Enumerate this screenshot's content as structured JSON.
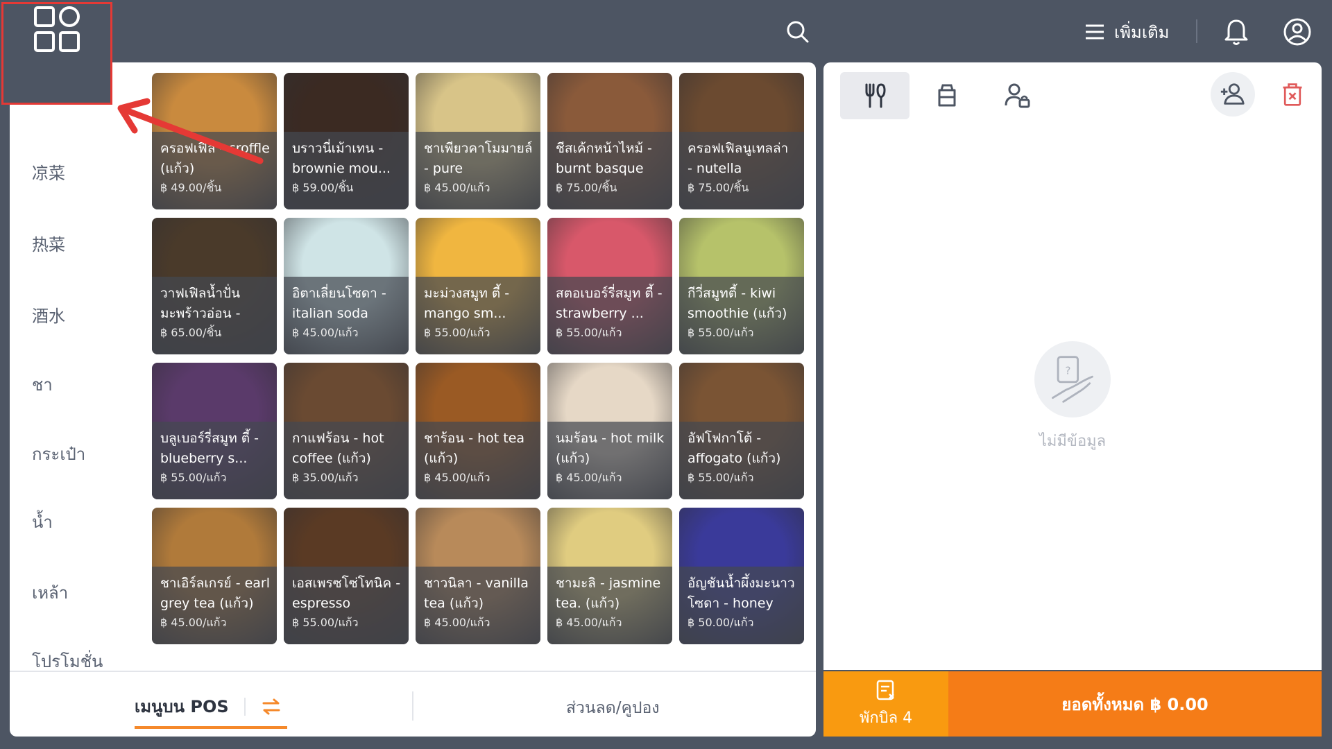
{
  "topbar": {
    "more_label": "เพิ่มเติม",
    "icons": [
      "apps-icon",
      "search-icon",
      "menu-icon",
      "bell-icon",
      "user-circle-icon"
    ]
  },
  "categories": [
    "凉菜",
    "热菜",
    "酒水",
    "ชา",
    "กระเป๋า",
    "น้ำ",
    "เหล้า",
    "โปรโมชั่น"
  ],
  "products": [
    {
      "name": "ครอฟเฟิล - croffle (แก้ว)",
      "price": "฿ 49.00/ชิ้น",
      "color": "#c98a3e"
    },
    {
      "name": "บราวนี่เม้าเทน - brownie mou...",
      "price": "฿ 59.00/ชิ้น",
      "color": "#3b2a22"
    },
    {
      "name": "ชาเพียวคาโมมายล์ - pure camomil...",
      "price": "฿ 45.00/แก้ว",
      "color": "#d8c488"
    },
    {
      "name": "ชีสเค้กหน้าไหม้ - burnt basque c...",
      "price": "฿ 75.00/ชิ้น",
      "color": "#8a5a3a"
    },
    {
      "name": "ครอฟเฟิลนูเทลล่า - nutella croffle...",
      "price": "฿ 75.00/ชิ้น",
      "color": "#6b4a30"
    },
    {
      "name": "วาฟเฟิลน้ำปั่น มะพร้าวอ่อน - ba...",
      "price": "฿ 65.00/ชิ้น",
      "color": "#4a3a2a"
    },
    {
      "name": "อิตาเลี่ยนโซดา - italian soda (แก้ว)",
      "price": "฿ 45.00/แก้ว",
      "color": "#cfe4e6"
    },
    {
      "name": "มะม่วงสมูท ตี้ - mango sm...",
      "price": "฿ 55.00/แก้ว",
      "color": "#f0b640"
    },
    {
      "name": "สตอเบอร์รี่สมูท ตี้ - strawberry ...",
      "price": "฿ 55.00/แก้ว",
      "color": "#d8586a"
    },
    {
      "name": "กีวี่สมูทตี้ - kiwi smoothie (แก้ว)",
      "price": "฿ 55.00/แก้ว",
      "color": "#b6c26a"
    },
    {
      "name": "บลูเบอร์รี่สมูท ตี้ - blueberry s...",
      "price": "฿ 55.00/แก้ว",
      "color": "#5a3a6a"
    },
    {
      "name": "กาแฟร้อน - hot coffee (แก้ว)",
      "price": "฿ 35.00/แก้ว",
      "color": "#6a4a32"
    },
    {
      "name": "ชาร้อน - hot tea (แก้ว)",
      "price": "฿ 45.00/แก้ว",
      "color": "#9a5a24"
    },
    {
      "name": "นมร้อน - hot milk (แก้ว)",
      "price": "฿ 45.00/แก้ว",
      "color": "#e6d8c6"
    },
    {
      "name": "อัฟโฟกาโต้ - affogato (แก้ว)",
      "price": "฿ 55.00/แก้ว",
      "color": "#7a5434"
    },
    {
      "name": "ชาเอิร์ลเกรย์ - earl grey tea (แก้ว)",
      "price": "฿ 45.00/แก้ว",
      "color": "#b07a3a"
    },
    {
      "name": "เอสเพรซโซ่โทนิค - espresso tonic....",
      "price": "฿ 55.00/แก้ว",
      "color": "#5a3a24"
    },
    {
      "name": "ชาวนิลา - vanilla tea (แก้ว)",
      "price": "฿ 45.00/แก้ว",
      "color": "#b88a5a"
    },
    {
      "name": "ชามะลิ - jasmine tea. (แก้ว)",
      "price": "฿ 45.00/แก้ว",
      "color": "#e0cc80"
    },
    {
      "name": "อัญชันน้ำผึ้งมะนาว โซดา - honey le...",
      "price": "฿ 50.00/แก้ว",
      "color": "#3a3a9a"
    }
  ],
  "tabs": {
    "pos_menu": "เมนูบน POS",
    "discount": "ส่วนลด/คูปอง"
  },
  "right_panel": {
    "icons": [
      "utensils-icon",
      "bag-icon",
      "user-lock-icon",
      "add-user-icon",
      "trash-icon"
    ],
    "empty_text": "ไม่มีข้อมูล",
    "hold_label": "พักบิล 4",
    "total_label": "ยอดทั้งหมด ฿ 0.00"
  },
  "colors": {
    "topbar": "#4d5563",
    "accent_orange": "#f57c17",
    "hold_orange": "#f99a10",
    "highlight_red": "#e53935"
  }
}
